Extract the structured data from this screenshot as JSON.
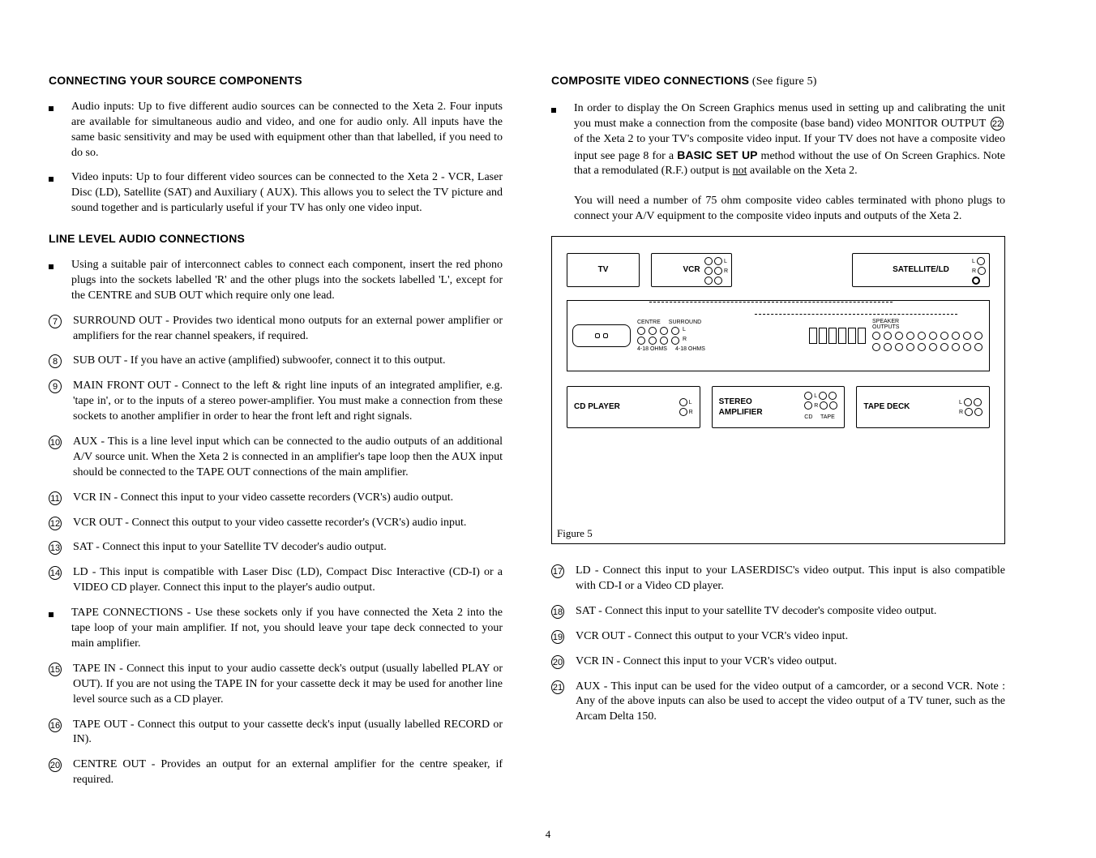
{
  "page_number": "4",
  "left": {
    "h1": "CONNECTING YOUR SOURCE COMPONENTS",
    "b1": "Audio inputs: Up to five different audio sources can be connected to the Xeta 2. Four inputs are available for simultaneous audio and video, and one for audio only. All inputs have the same basic sensitivity and may be used with equipment other than that labelled, if you need to do so.",
    "b2": "Video inputs: Up to four different video sources can be connected to the Xeta 2 - VCR, Laser Disc (LD), Satellite (SAT) and Auxiliary ( AUX). This allows you to select the TV picture and sound together and is particularly useful if your TV has only one video input.",
    "h2": "LINE LEVEL AUDIO CONNECTIONS",
    "b3": "Using a suitable pair of interconnect cables to connect each component, insert the red phono plugs into the sockets labelled 'R' and the other plugs into the sockets labelled 'L', except for the CENTRE and SUB OUT which require only one lead.",
    "n7": "SURROUND OUT - Provides two identical mono outputs for an external power amplifier or amplifiers for the rear channel speakers, if required.",
    "n8": "SUB OUT - If you have an active (amplified) subwoofer, connect it to this output.",
    "n9": "MAIN FRONT OUT - Connect to the left & right line inputs of an integrated amplifier, e.g. 'tape in', or to the inputs of a stereo power-amplifier. You must make a connection from these sockets to another amplifier in order to hear the front left and right signals.",
    "n10": "AUX - This is a line level input which can be connected to the audio outputs of an additional A/V source unit. When the Xeta 2 is connected in an amplifier's tape loop then the AUX input should be connected to the TAPE OUT connections of the main amplifier.",
    "n11": "VCR IN - Connect this input to your video cassette recorders (VCR's) audio output.",
    "n12": "VCR OUT - Connect this output to your video cassette recorder's (VCR's) audio input.",
    "n13": "SAT - Connect this input to your Satellite TV decoder's audio output.",
    "n14": "LD - This input is compatible with Laser Disc (LD), Compact Disc Interactive (CD-I) or a VIDEO CD player. Connect this input to the player's audio output.",
    "b4": "TAPE CONNECTIONS - Use these sockets only if you have connected the Xeta 2 into the tape loop of your main amplifier. If not, you should leave your tape deck connected to your main amplifier.",
    "n15": "TAPE IN - Connect this input to your audio cassette deck's output (usually labelled PLAY or OUT). If you are not using the TAPE IN for your cassette deck it may be used for another line level source such as a CD player.",
    "n16": "TAPE OUT - Connect this output to your cassette deck's input (usually labelled RECORD or IN).",
    "n20": "CENTRE OUT - Provides an output for an external amplifier for the centre speaker, if required."
  },
  "right": {
    "h1_a": "COMPOSITE VIDEO CONNECTIONS",
    "h1_b": " (See figure 5)",
    "p1_a": "In order to display the On Screen Graphics menus used in setting up and calibrating the unit you must make a connection from the composite (base band) video MONITOR OUTPUT ",
    "p1_num": "22",
    "p1_b": " of the Xeta 2 to your TV's composite video input. If your TV does not have a composite video input see page 8 for a ",
    "p1_basic": "BASIC SET UP",
    "p1_c": " method without the use of On Screen Graphics. Note that a remodulated (R.F.) output is ",
    "p1_not": "not",
    "p1_d": " available on the Xeta 2.",
    "p2": "You will need a number of 75 ohm composite video cables terminated with phono plugs to connect your A/V equipment to the composite video inputs and outputs of the Xeta 2.",
    "fig": {
      "tv": "TV",
      "vcr": "VCR",
      "sat": "SATELLITE/LD",
      "centre": "CENTRE",
      "surround": "SURROUND",
      "speaker_outputs": "SPEAKER\nOUTPUTS",
      "ohm": "4-18 OHMS",
      "cd": "CD PLAYER",
      "amp": "STEREO\nAMPLIFIER",
      "cd_lbl": "CD",
      "tape_lbl": "TAPE",
      "tape": "TAPE DECK",
      "caption": "Figure 5"
    },
    "n17": "LD - Connect this input to your LASERDISC's video output. This input is also compatible with CD-I or a Video CD player.",
    "n18": "SAT - Connect this input to your satellite TV decoder's composite video output.",
    "n19": "VCR OUT - Connect this output to your VCR's video input.",
    "n20": "VCR IN - Connect this input to your VCR's video output.",
    "n21": "AUX - This input can be used for the video output of a camcorder, or a second VCR. Note : Any of the above inputs can also be used to accept the video output of a TV tuner, such as the Arcam Delta 150."
  }
}
